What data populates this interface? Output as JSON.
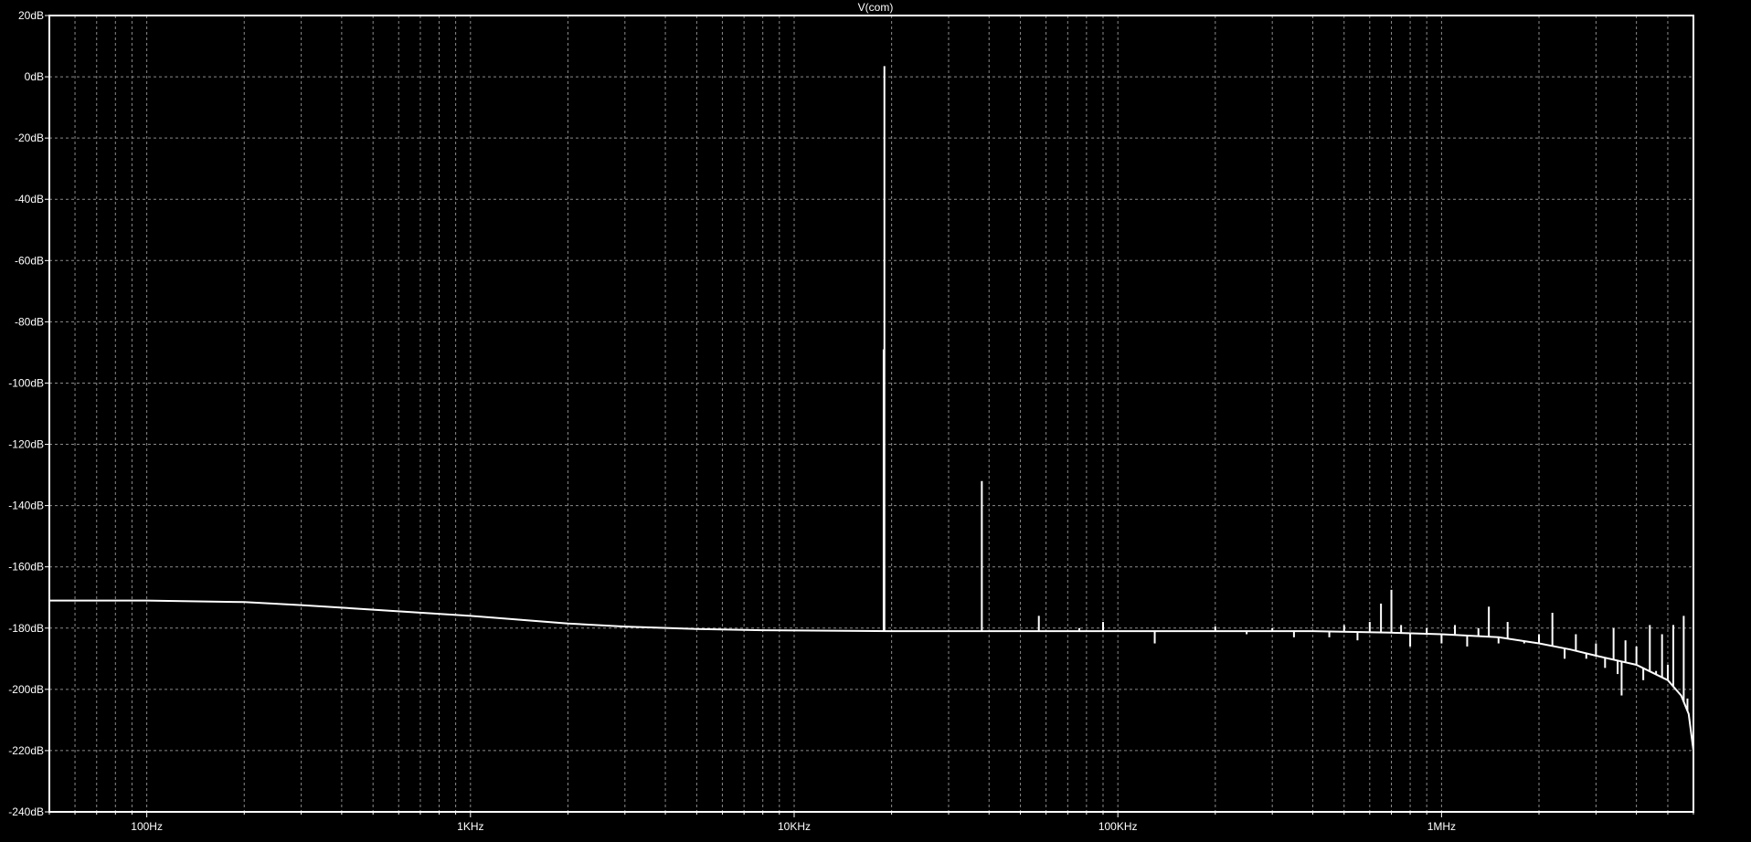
{
  "window": {
    "trace_title": "V(com)"
  },
  "colors": {
    "background": "#000000",
    "trace": "#ffffff",
    "grid": "#8a8a8a",
    "frame": "#ffffff",
    "text": "#ffffff"
  },
  "chart_data": {
    "type": "line",
    "title": "V(com)",
    "xlabel": "",
    "ylabel": "",
    "x_scale": "log",
    "x_unit": "Hz",
    "y_unit": "dB",
    "xlim": [
      50,
      6000000
    ],
    "ylim": [
      -240,
      20
    ],
    "grid": true,
    "legend": "none",
    "y_ticks": [
      {
        "value": 20,
        "label": "20dB"
      },
      {
        "value": 0,
        "label": "0dB"
      },
      {
        "value": -20,
        "label": "-20dB"
      },
      {
        "value": -40,
        "label": "-40dB"
      },
      {
        "value": -60,
        "label": "-60dB"
      },
      {
        "value": -80,
        "label": "-80dB"
      },
      {
        "value": -100,
        "label": "-100dB"
      },
      {
        "value": -120,
        "label": "-120dB"
      },
      {
        "value": -140,
        "label": "-140dB"
      },
      {
        "value": -160,
        "label": "-160dB"
      },
      {
        "value": -180,
        "label": "-180dB"
      },
      {
        "value": -200,
        "label": "-200dB"
      },
      {
        "value": -220,
        "label": "-220dB"
      },
      {
        "value": -240,
        "label": "-240dB"
      }
    ],
    "x_ticks": [
      {
        "value": 100,
        "label": "100Hz"
      },
      {
        "value": 1000,
        "label": "1KHz"
      },
      {
        "value": 10000,
        "label": "10KHz"
      },
      {
        "value": 100000,
        "label": "100KHz"
      },
      {
        "value": 1000000,
        "label": "1MHz"
      }
    ],
    "series": [
      {
        "baseline": [
          [
            50,
            -171
          ],
          [
            100,
            -171
          ],
          [
            200,
            -171.5
          ],
          [
            300,
            -172.5
          ],
          [
            500,
            -174
          ],
          [
            1000,
            -176
          ],
          [
            2000,
            -178.5
          ],
          [
            3000,
            -179.5
          ],
          [
            5000,
            -180.3
          ],
          [
            8000,
            -180.7
          ],
          [
            20000,
            -181
          ],
          [
            100000,
            -181
          ],
          [
            200000,
            -181
          ],
          [
            400000,
            -181
          ],
          [
            700000,
            -181.5
          ],
          [
            1000000,
            -182
          ],
          [
            1500000,
            -183
          ],
          [
            2000000,
            -185
          ],
          [
            2500000,
            -187
          ],
          [
            3000000,
            -189
          ],
          [
            4000000,
            -192
          ],
          [
            5000000,
            -197
          ],
          [
            5500000,
            -202
          ],
          [
            5800000,
            -208
          ],
          [
            6000000,
            -220
          ]
        ],
        "spikes": [
          [
            19000,
            3.5
          ],
          [
            18900,
            -89
          ],
          [
            38000,
            -132
          ],
          [
            57000,
            -176
          ],
          [
            76000,
            -180
          ],
          [
            90000,
            -178
          ],
          [
            130000,
            -185
          ],
          [
            200000,
            -179.5
          ],
          [
            250000,
            -182
          ],
          [
            300000,
            -180
          ],
          [
            350000,
            -183
          ],
          [
            400000,
            -181
          ],
          [
            450000,
            -183
          ],
          [
            500000,
            -179
          ],
          [
            550000,
            -184
          ],
          [
            600000,
            -178
          ],
          [
            650000,
            -172
          ],
          [
            700000,
            -167.5
          ],
          [
            750000,
            -179
          ],
          [
            800000,
            -186
          ],
          [
            900000,
            -180
          ],
          [
            1000000,
            -185
          ],
          [
            1100000,
            -179
          ],
          [
            1200000,
            -186
          ],
          [
            1300000,
            -180
          ],
          [
            1400000,
            -173
          ],
          [
            1500000,
            -185
          ],
          [
            1600000,
            -178
          ],
          [
            1800000,
            -185
          ],
          [
            2000000,
            -182
          ],
          [
            2200000,
            -175
          ],
          [
            2400000,
            -190
          ],
          [
            2600000,
            -182
          ],
          [
            2800000,
            -190
          ],
          [
            3000000,
            -185
          ],
          [
            3200000,
            -193
          ],
          [
            3400000,
            -180
          ],
          [
            3500000,
            -195
          ],
          [
            3600000,
            -202
          ],
          [
            3700000,
            -184
          ],
          [
            4000000,
            -186
          ],
          [
            4200000,
            -197
          ],
          [
            4400000,
            -179
          ],
          [
            4600000,
            -194
          ],
          [
            4800000,
            -182
          ],
          [
            5000000,
            -192
          ],
          [
            5200000,
            -179
          ],
          [
            5600000,
            -176
          ],
          [
            5750000,
            -203
          ]
        ]
      }
    ]
  }
}
